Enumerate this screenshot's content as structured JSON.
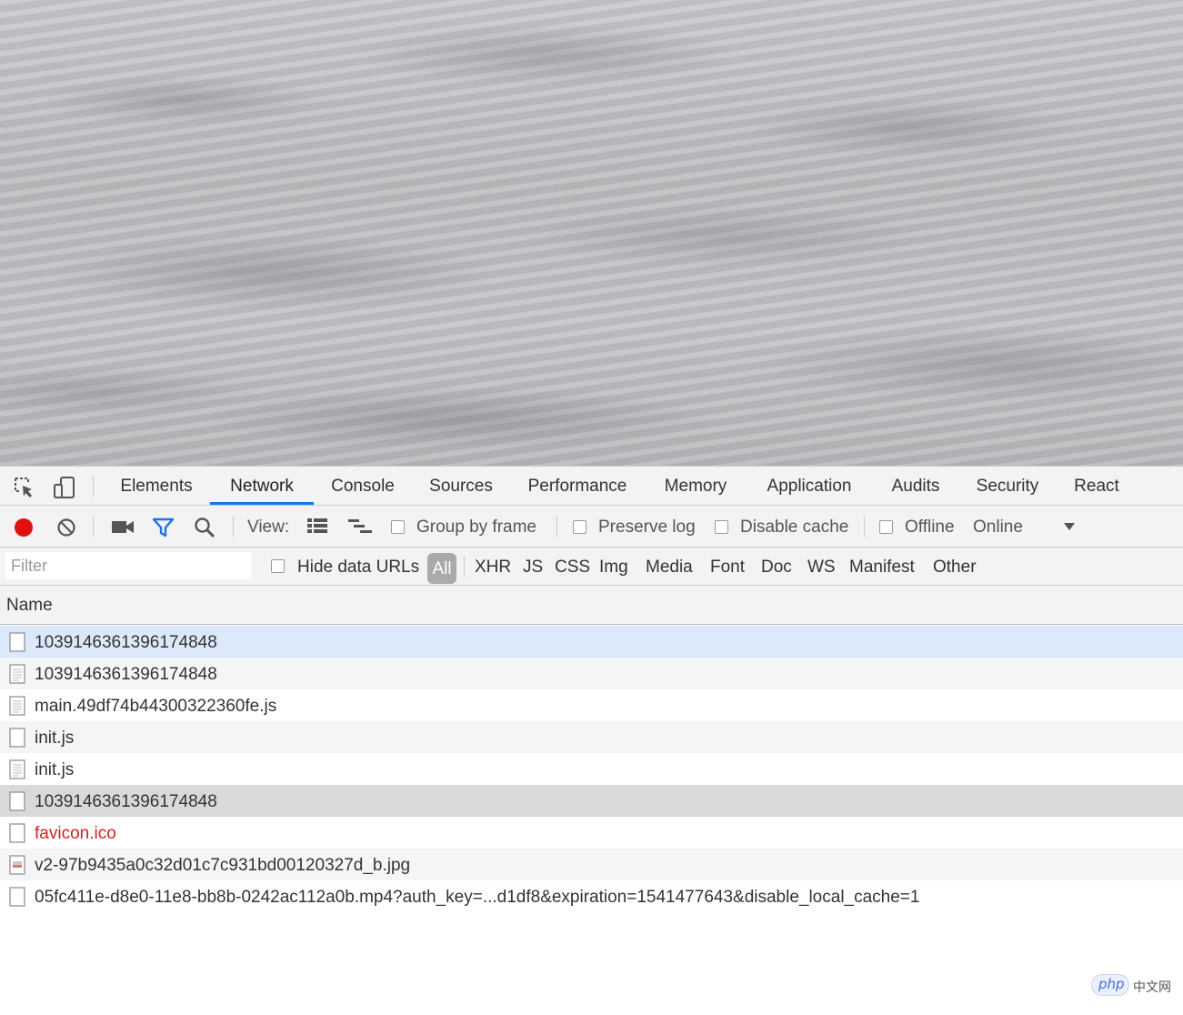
{
  "devtools": {
    "tabs": [
      {
        "label": "Elements",
        "active": false
      },
      {
        "label": "Network",
        "active": true
      },
      {
        "label": "Console",
        "active": false
      },
      {
        "label": "Sources",
        "active": false
      },
      {
        "label": "Performance",
        "active": false
      },
      {
        "label": "Memory",
        "active": false
      },
      {
        "label": "Application",
        "active": false
      },
      {
        "label": "Audits",
        "active": false
      },
      {
        "label": "Security",
        "active": false
      },
      {
        "label": "React",
        "active": false
      }
    ],
    "accent_color": "#1a73e8",
    "record_color": "#e01010"
  },
  "toolbar": {
    "view_label": "View:",
    "group_by_frame": {
      "label": "Group by frame",
      "checked": false
    },
    "preserve_log": {
      "label": "Preserve log",
      "checked": false
    },
    "disable_cache": {
      "label": "Disable cache",
      "checked": false
    },
    "offline": {
      "label": "Offline",
      "checked": false
    },
    "throttle_value": "Online"
  },
  "filterbar": {
    "filter_placeholder": "Filter",
    "hide_data_urls": {
      "label": "Hide data URLs",
      "checked": false
    },
    "types": [
      "All",
      "XHR",
      "JS",
      "CSS",
      "Img",
      "Media",
      "Font",
      "Doc",
      "WS",
      "Manifest",
      "Other"
    ],
    "selected_type": "All"
  },
  "table": {
    "header": "Name",
    "rows": [
      {
        "name": "1039146361396174848",
        "icon": "document-icon",
        "state": "selected",
        "error": false
      },
      {
        "name": "1039146361396174848",
        "icon": "script-icon",
        "state": "normal",
        "error": false
      },
      {
        "name": "main.49df74b44300322360fe.js",
        "icon": "script-icon",
        "state": "normal",
        "error": false
      },
      {
        "name": "init.js",
        "icon": "document-icon",
        "state": "normal",
        "error": false
      },
      {
        "name": "init.js",
        "icon": "script-icon",
        "state": "normal",
        "error": false
      },
      {
        "name": "1039146361396174848",
        "icon": "document-icon",
        "state": "hover",
        "error": false
      },
      {
        "name": "favicon.ico",
        "icon": "document-icon",
        "state": "normal",
        "error": true
      },
      {
        "name": "v2-97b9435a0c32d01c7c931bd00120327d_b.jpg",
        "icon": "image-icon",
        "state": "normal",
        "error": false
      },
      {
        "name": "05fc411e-d8e0-11e8-bb8b-0242ac112a0b.mp4?auth_key=...d1df8&expiration=1541477643&disable_local_cache=1",
        "icon": "document-icon",
        "state": "normal",
        "error": false
      }
    ]
  },
  "watermark": {
    "brand": "php",
    "site": "中文网"
  }
}
